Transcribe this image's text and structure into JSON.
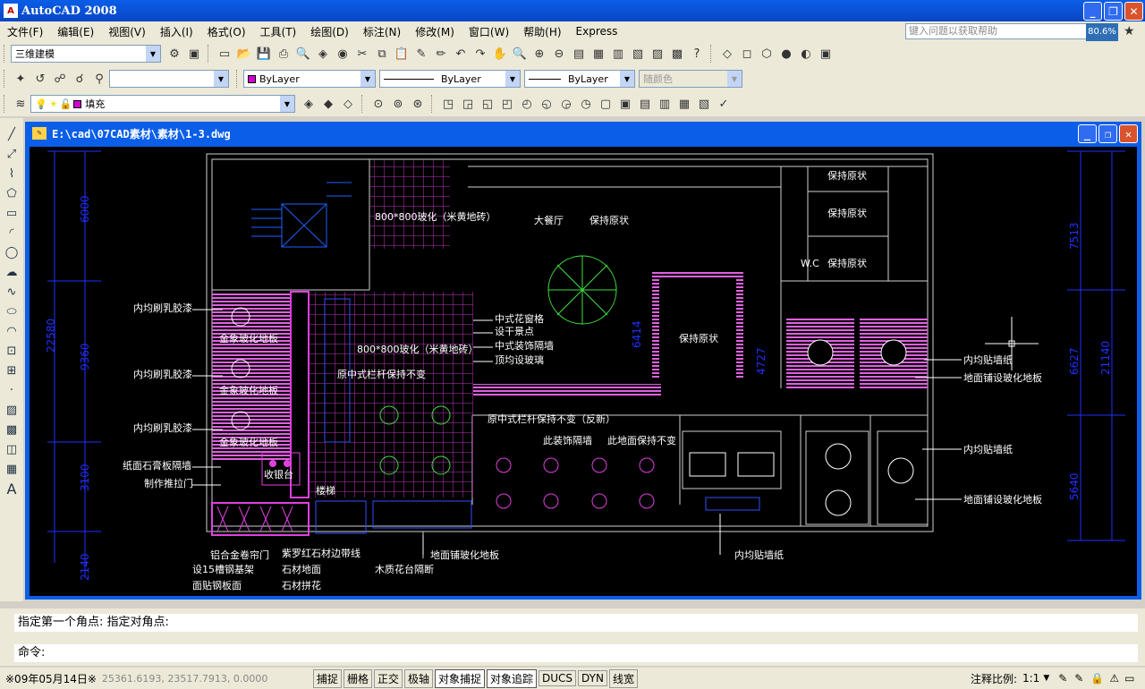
{
  "app": {
    "title": "AutoCAD 2008",
    "icon": "autocad-app-icon"
  },
  "menu": [
    "文件(F)",
    "编辑(E)",
    "视图(V)",
    "插入(I)",
    "格式(O)",
    "工具(T)",
    "绘图(D)",
    "标注(N)",
    "修改(M)",
    "窗口(W)",
    "帮助(H)",
    "Express"
  ],
  "help_search": {
    "placeholder": "键入问题以获取帮助"
  },
  "zoom_badge": "80.6%",
  "toolbar1": {
    "workspace": "三维建模"
  },
  "toolbar2": {
    "layer_combo": "",
    "color": "ByLayer",
    "linetype": "ByLayer",
    "lineweight": "ByLayer",
    "plotstyle": "随颜色"
  },
  "toolbar3": {
    "layer_name": "填充"
  },
  "drawing": {
    "title": "E:\\cad\\07CAD素材\\素材\\1-3.dwg"
  },
  "canvas_labels": {
    "dim_left_1": "6000",
    "dim_left_2": "22580",
    "dim_left_3": "9360",
    "dim_left_4": "3100",
    "dim_left_5": "2140",
    "dim_right_1": "7513",
    "dim_right_2": "21140",
    "dim_right_3": "6627",
    "dim_right_4": "5640",
    "dim_mid_1": "6414",
    "dim_mid_2": "4727",
    "tile_top": "800*800玻化（米黄地砖）",
    "dining": "大餐厅",
    "keep1": "保持原状",
    "keep_r1": "保持原状",
    "keep_r2": "保持原状",
    "keep_r3": "保持原状",
    "wc": "W.C",
    "keep_mid": "保持原状",
    "latex1": "内均刷乳胶漆",
    "latex2": "内均刷乳胶漆",
    "latex3": "内均刷乳胶漆",
    "tile_l1": "金象玻化地板",
    "tile_l2": "金象玻化地板",
    "tile_l3": "金象玻化地板",
    "gypsum": "纸面石膏板隔墙",
    "door": "制作推拉门",
    "cashier": "收银台",
    "stairs": "楼梯",
    "lattice": "中式花窗格",
    "plants": "设干景点",
    "partition": "中式装饰隔墙",
    "ceiling": "顶均设玻璃",
    "tile_center": "800*800玻化（米黄地砖）",
    "railing": "原中式栏杆保持不变",
    "railing2": "原中式栏杆保持不变（反新）",
    "partition2": "此装饰隔墙",
    "floor_keep": "此地面保持不变",
    "wallpaper_r1": "内均贴墙纸",
    "floor_r1": "地面铺设玻化地板",
    "wallpaper_r2": "内均贴墙纸",
    "floor_r2": "地面铺设玻化地板",
    "wallpaper_b": "内均贴墙纸",
    "floor_b": "地面铺玻化地板",
    "wood_partition": "木质花台隔断",
    "b1": "铝合金卷帘门",
    "b2": "设15槽钢基架",
    "b3": "面贴钢板面",
    "b4": "紫罗红石材边带线",
    "b5": "石材地面",
    "b6": "石材拼花"
  },
  "command": {
    "history": "指定第一个角点: 指定对角点:",
    "prompt": "命令:"
  },
  "status": {
    "date": "※09年05月14日※",
    "coords": "25361.6193,  23517.7913, 0.0000",
    "toggles": [
      "捕捉",
      "栅格",
      "正交",
      "极轴",
      "对象捕捉",
      "对象追踪",
      "DUCS",
      "DYN",
      "线宽"
    ],
    "scale_label": "注释比例:",
    "scale_value": "1:1"
  }
}
